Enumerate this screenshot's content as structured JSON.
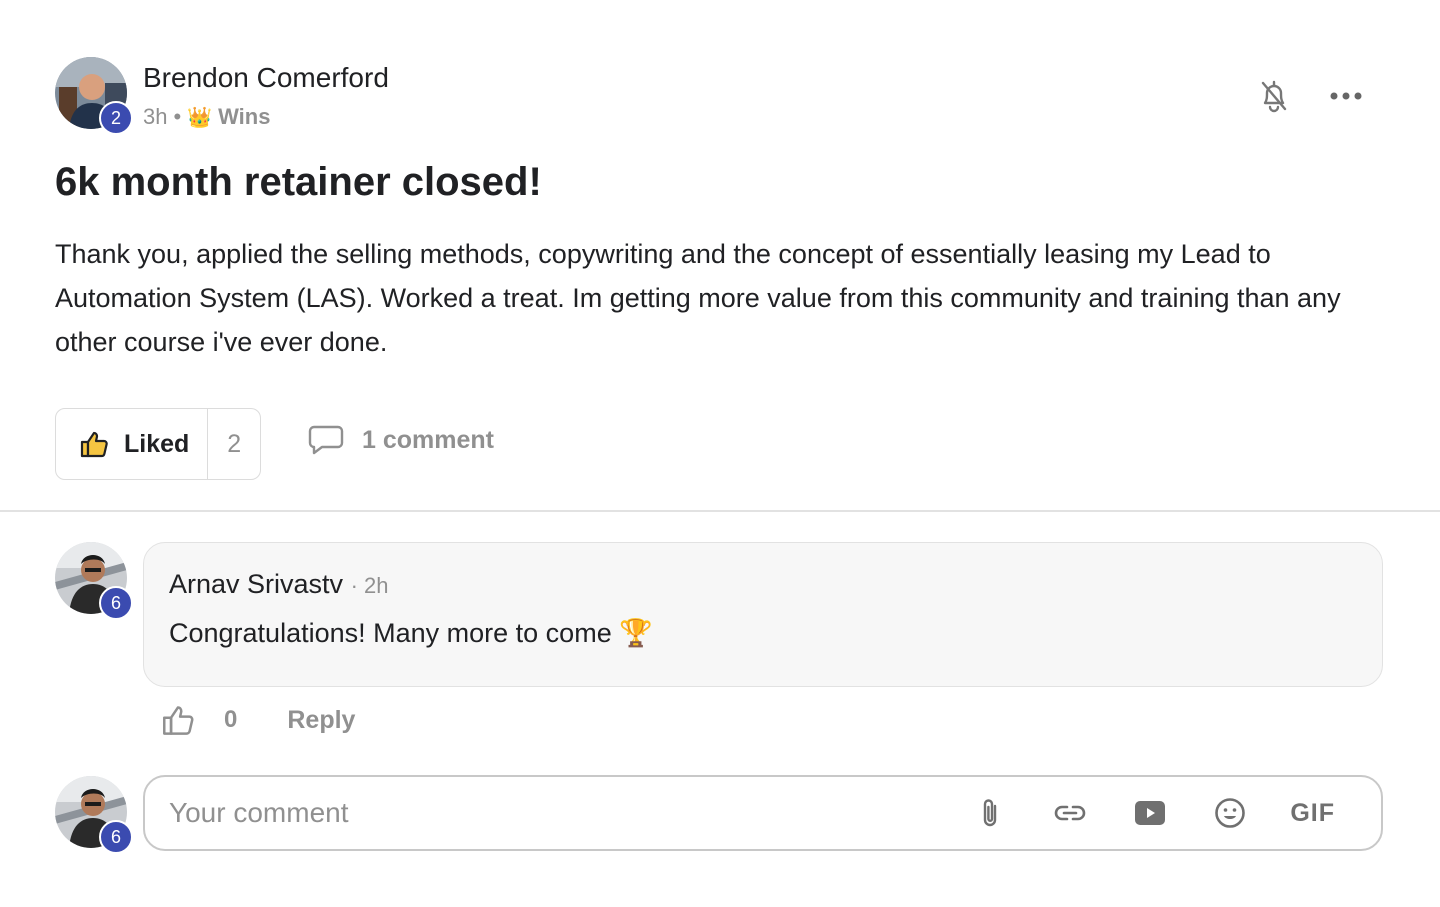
{
  "post": {
    "author": "Brendon Comerford",
    "author_level": "2",
    "time": "3h",
    "category_emoji": "👑",
    "category": "Wins",
    "title": "6k month retainer closed!",
    "body": "Thank you, applied the selling methods, copywriting and the concept of essentially leasing my Lead to Automation System (LAS). Worked a treat. Im getting more value from this community and training than any other course i've ever done.",
    "liked_label": "Liked",
    "like_count": "2",
    "comments_label": "1 comment"
  },
  "comment": {
    "author": "Arnav Srivastv",
    "author_level": "6",
    "time": "· 2h",
    "text": "Congratulations! Many more to come 🏆",
    "like_count": "0",
    "reply_label": "Reply"
  },
  "composer": {
    "avatar_level": "6",
    "placeholder": "Your comment",
    "gif_label": "GIF"
  },
  "icons": {
    "bell": "bell-off-icon",
    "more": "more-horizontal-icon",
    "thumbs_up": "thumbs-up-icon",
    "comment": "comment-bubble-icon",
    "attach": "paperclip-icon",
    "link": "link-icon",
    "video": "video-icon",
    "emoji": "emoji-icon"
  },
  "colors": {
    "level_badge": "#3b4bb0",
    "muted_text": "#909090",
    "text": "#202124"
  }
}
